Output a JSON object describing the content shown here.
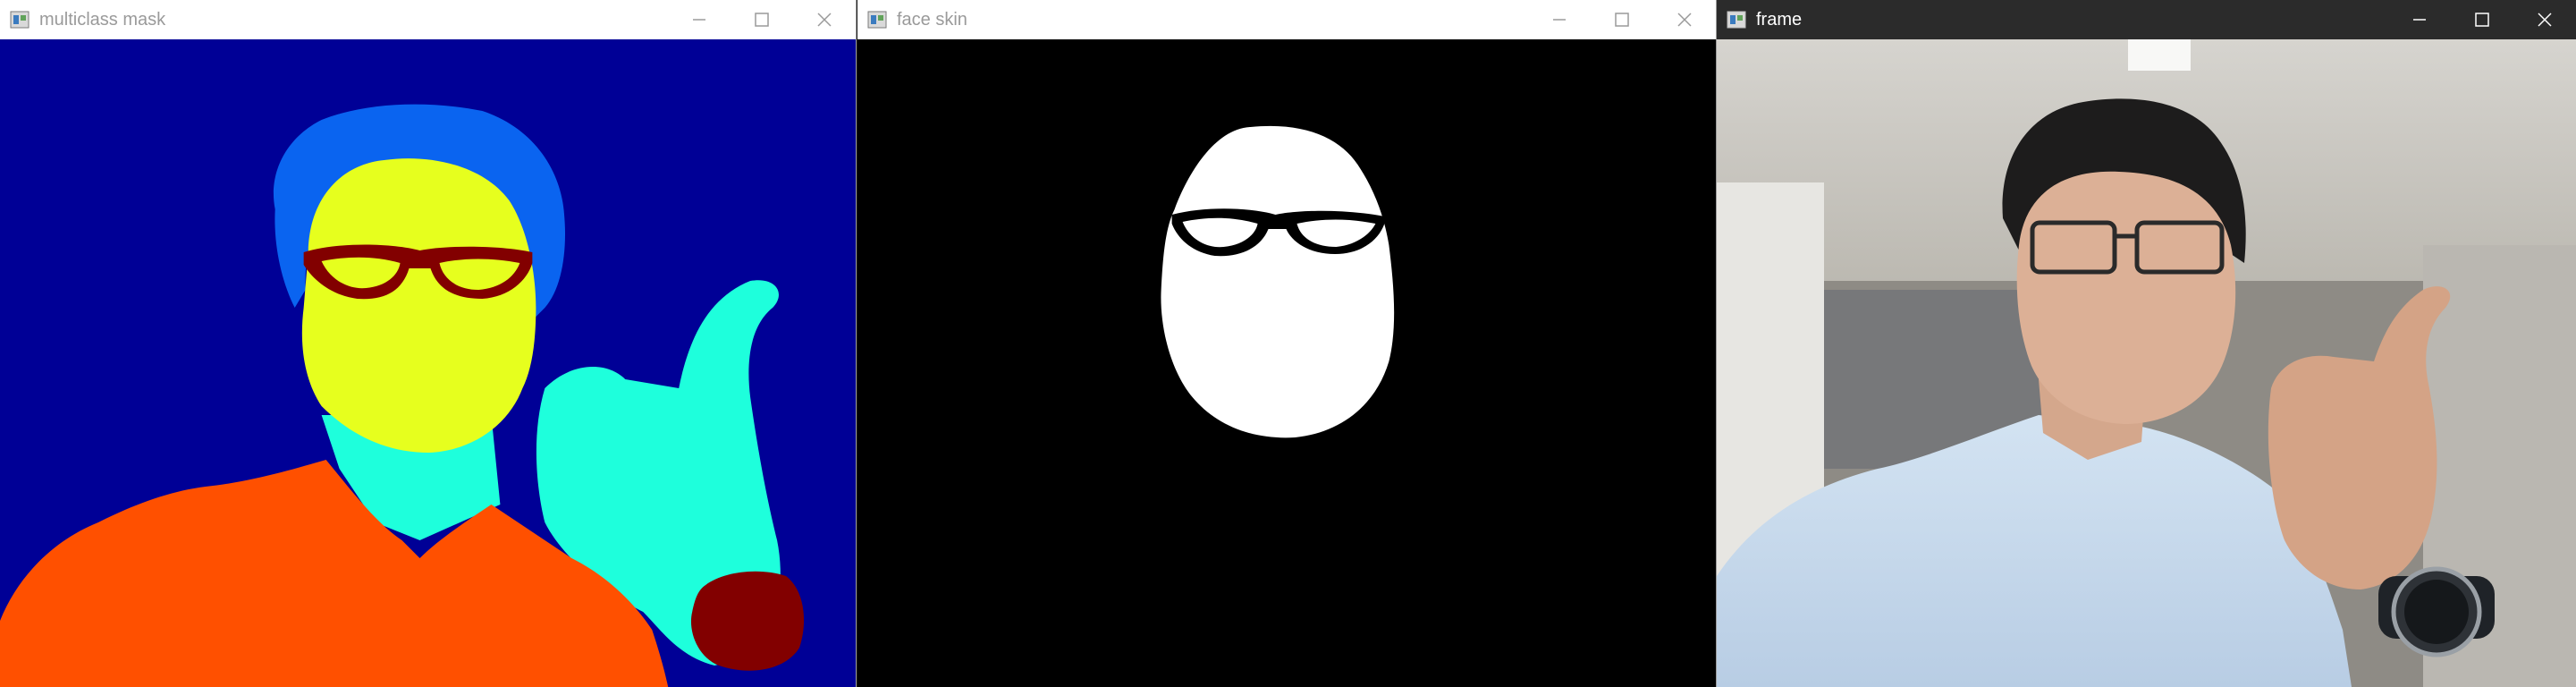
{
  "windows": [
    {
      "title": "multiclass mask"
    },
    {
      "title": "face skin"
    },
    {
      "title": "frame"
    }
  ],
  "colors": {
    "mask_background": "#000096",
    "mask_hair": "#0a64f0",
    "mask_face": "#e6ff1e",
    "mask_glasses": "#820000",
    "mask_body": "#ff5000",
    "mask_skin_other": "#1effdc",
    "mask_accessory": "#820000",
    "skin_background": "#000000",
    "skin_face": "#ffffff"
  },
  "icons": {
    "app": "opencv-window-icon",
    "minimize": "minimize-icon",
    "maximize": "maximize-icon",
    "close": "close-icon"
  }
}
